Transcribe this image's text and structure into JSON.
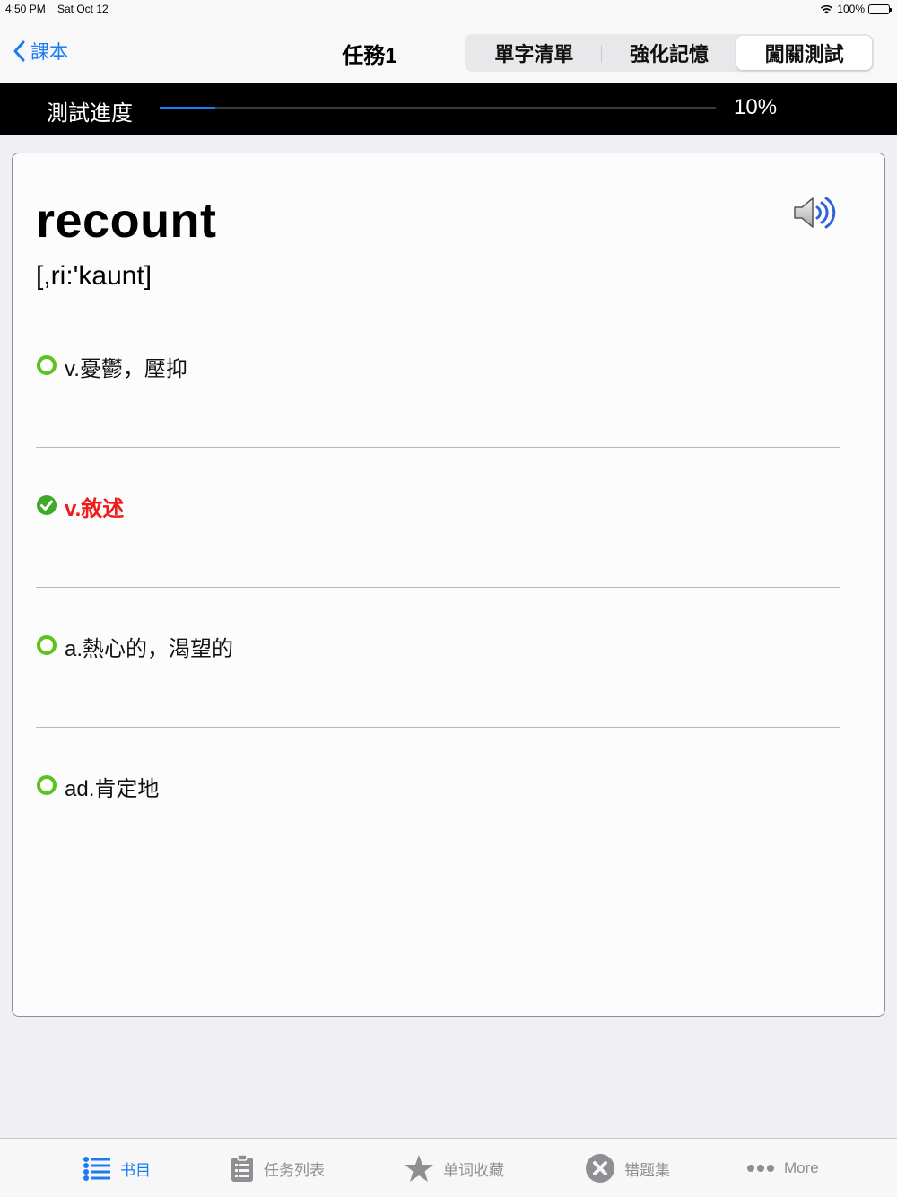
{
  "status_bar": {
    "time": "4:50 PM",
    "date": "Sat Oct 12",
    "battery": "100%"
  },
  "nav": {
    "back_label": "課本",
    "title": "任務1",
    "segments": [
      "單字清單",
      "強化記憶",
      "闖關測試"
    ],
    "active_segment": 2
  },
  "progress": {
    "label": "測試進度",
    "percent_text": "10%",
    "fraction": 0.1
  },
  "card": {
    "word": "recount",
    "phonetic": "[,ri:'kaunt]",
    "speaker_icon": "speaker-icon",
    "options": [
      {
        "text": "v.憂鬱，壓抑",
        "state": "unselected"
      },
      {
        "text": "v.敘述",
        "state": "correct"
      },
      {
        "text": "a.熱心的，渴望的",
        "state": "unselected"
      },
      {
        "text": "ad.肯定地",
        "state": "unselected"
      }
    ]
  },
  "tab_bar": {
    "tabs": [
      {
        "label": "书目",
        "icon": "list-icon",
        "active": true
      },
      {
        "label": "任务列表",
        "icon": "clipboard-icon",
        "active": false
      },
      {
        "label": "单词收藏",
        "icon": "star-icon",
        "active": false
      },
      {
        "label": "错题集",
        "icon": "x-circle-icon",
        "active": false
      },
      {
        "label": "More",
        "icon": "more-icon",
        "active": false
      }
    ]
  },
  "colors": {
    "accent": "#1a7cf5",
    "correct_text": "#ee1b1b",
    "radio_green": "#5cc21e"
  }
}
